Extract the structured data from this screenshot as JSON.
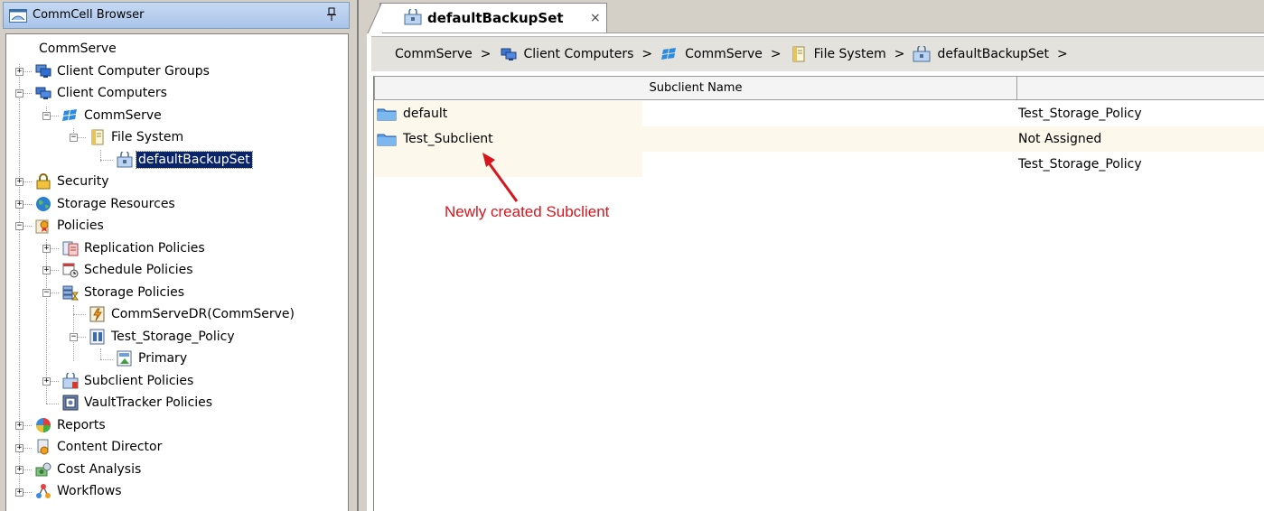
{
  "left_panel": {
    "title": "CommCell Browser",
    "tree": {
      "root": "CommServe",
      "client_computer_groups": "Client Computer Groups",
      "client_computers": "Client Computers",
      "commserve": "CommServe",
      "file_system": "File System",
      "default_backup_set": "defaultBackupSet",
      "security": "Security",
      "storage_resources": "Storage Resources",
      "policies": "Policies",
      "replication_policies": "Replication Policies",
      "schedule_policies": "Schedule Policies",
      "storage_policies": "Storage Policies",
      "commserve_dr": "CommServeDR(CommServe)",
      "test_storage_policy": "Test_Storage_Policy",
      "primary": "Primary",
      "subclient_policies": "Subclient Policies",
      "vaulttracker_policies": "VaultTracker Policies",
      "reports": "Reports",
      "content_director": "Content Director",
      "cost_analysis": "Cost Analysis",
      "workflows": "Workflows"
    }
  },
  "tab": {
    "title": "defaultBackupSet",
    "close_glyph": "×"
  },
  "breadcrumb": {
    "items": [
      "CommServe",
      "Client Computers",
      "CommServe",
      "File System",
      "defaultBackupSet"
    ],
    "separator": ">"
  },
  "table": {
    "columns": [
      "Subclient Name",
      ""
    ],
    "rows": [
      {
        "name": "default",
        "storage_policy": "Test_Storage_Policy"
      },
      {
        "name": "Test_Subclient",
        "storage_policy": "Not Assigned"
      },
      {
        "name": "",
        "storage_policy": "Test_Storage_Policy"
      }
    ]
  },
  "annotation": {
    "text": "Newly created Subclient",
    "color": "#d8141c"
  },
  "colors": {
    "selection": "#0a246a",
    "row_tint": "#fdf8ec",
    "annotation": "#d8141c"
  }
}
